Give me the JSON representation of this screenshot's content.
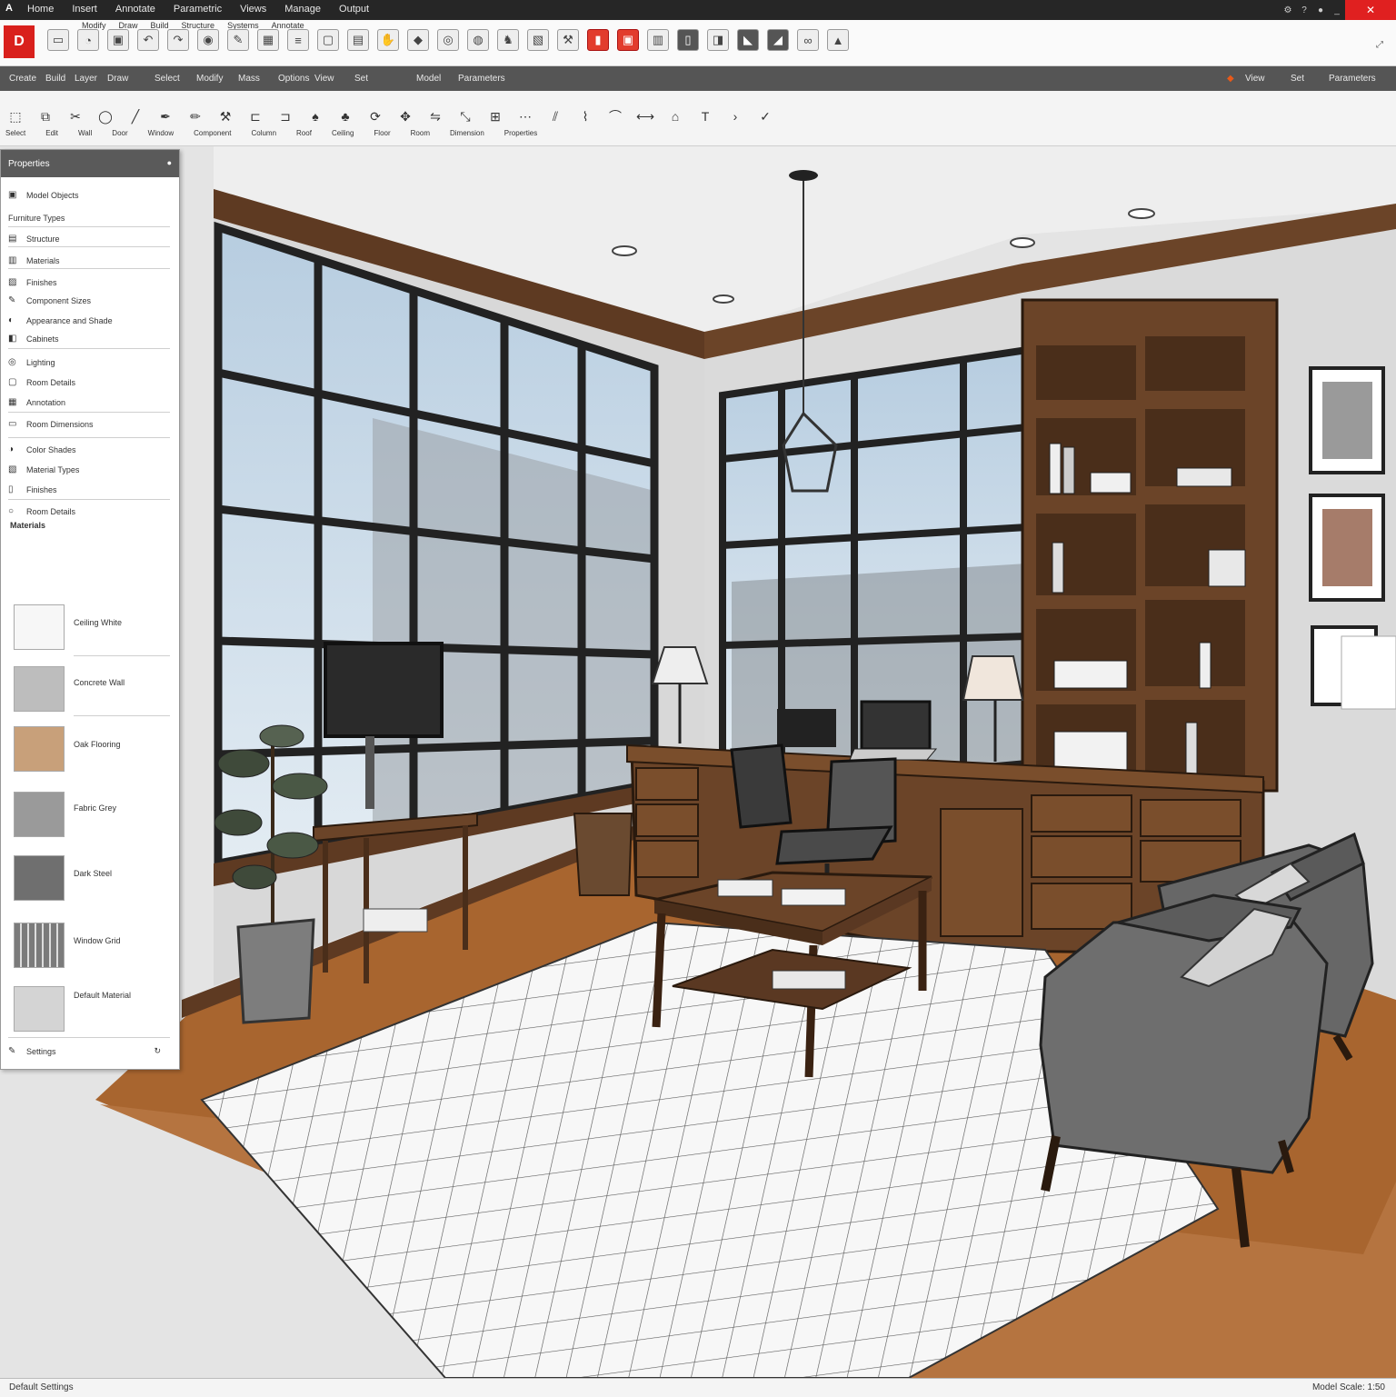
{
  "titlebar": {
    "menu": [
      "Home",
      "Insert",
      "Annotate",
      "Parametric",
      "Views",
      "Manage",
      "Output"
    ]
  },
  "ribbon": {
    "logo": "D",
    "labels": [
      "Modify",
      "Draw",
      "Build",
      "Structure",
      "Systems",
      "Annotate"
    ]
  },
  "menubar": {
    "items": [
      "Create",
      "Build",
      "Layer",
      "Draw",
      "Select",
      "Modify",
      "Mass",
      "Options",
      "View",
      "Set",
      "Model",
      "Parameters"
    ]
  },
  "toolbar2": {
    "labels": [
      "Select",
      "Edit",
      "Wall",
      "Door",
      "Window",
      "Component",
      "Column",
      "Roof",
      "Ceiling",
      "Floor",
      "Room",
      "Dimension",
      "Properties"
    ]
  },
  "panel": {
    "title": "Properties",
    "rows": [
      "Model Objects",
      "Furniture Types",
      "Structure",
      "Materials",
      "Finishes",
      "Component Sizes",
      "Appearance and Shade",
      "Cabinets",
      "Lighting",
      "Room Details",
      "Annotation",
      "Room Dimensions",
      "Color Shades",
      "Material Types"
    ],
    "section_label": "Materials",
    "swatches": [
      {
        "color": "#f7f7f7",
        "label": "Ceiling White"
      },
      {
        "color": "#bdbdbd",
        "label": "Concrete Wall"
      },
      {
        "color": "#c8a07a",
        "label": "Oak Flooring"
      },
      {
        "color": "#9a9a9a",
        "label": "Fabric Grey"
      },
      {
        "color": "#6f6f6f",
        "label": "Dark Steel"
      },
      {
        "color": "#7b7b7b",
        "label": "Window Grid"
      },
      {
        "color": "#d4d4d4",
        "label": "Default Material"
      }
    ],
    "footer": "Settings"
  },
  "statusbar": {
    "left": "Default Settings",
    "right": "Model Scale: 1:50"
  },
  "colors": {
    "accent": "#d9201c",
    "wood": "#5e3a22",
    "floor": "#b06e3a"
  }
}
